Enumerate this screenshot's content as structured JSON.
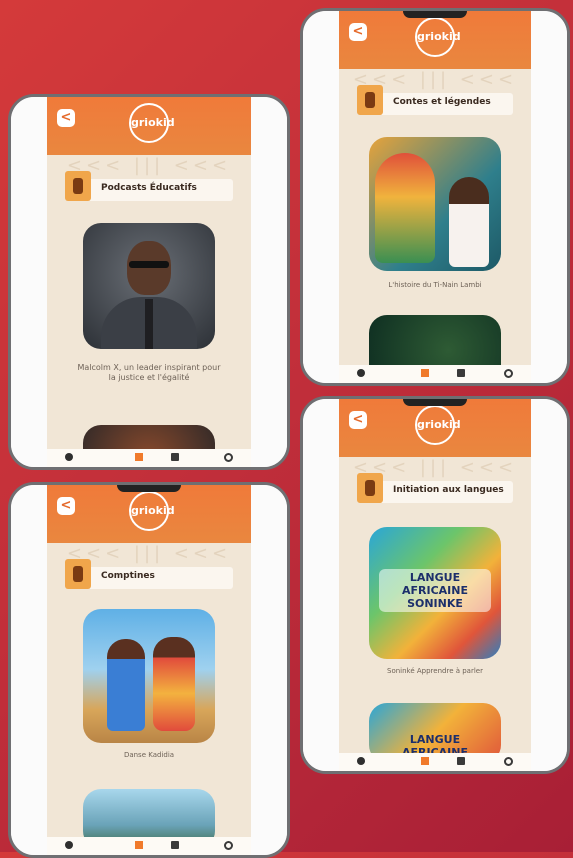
{
  "logo_text": "griokid",
  "back_label": "<",
  "pattern_text": "<<< ||| <<<",
  "phones": [
    {
      "section_title": "Podcasts Éducatifs",
      "card1_caption": "Malcolm X, un leader inspirant pour la justice et l'égalité"
    },
    {
      "section_title": "Contes et légendes",
      "card1_caption": "L'histoire du Ti-Nain Lambi"
    },
    {
      "section_title": "Comptines",
      "card1_caption": "Danse Kadidia"
    },
    {
      "section_title": "Initiation aux langues",
      "card1_caption": "Soninké    Apprendre à parler",
      "card1_text": "LANGUE AFRICAINE SONINKE",
      "card2_text": "LANGUE AFRICAINE"
    }
  ]
}
